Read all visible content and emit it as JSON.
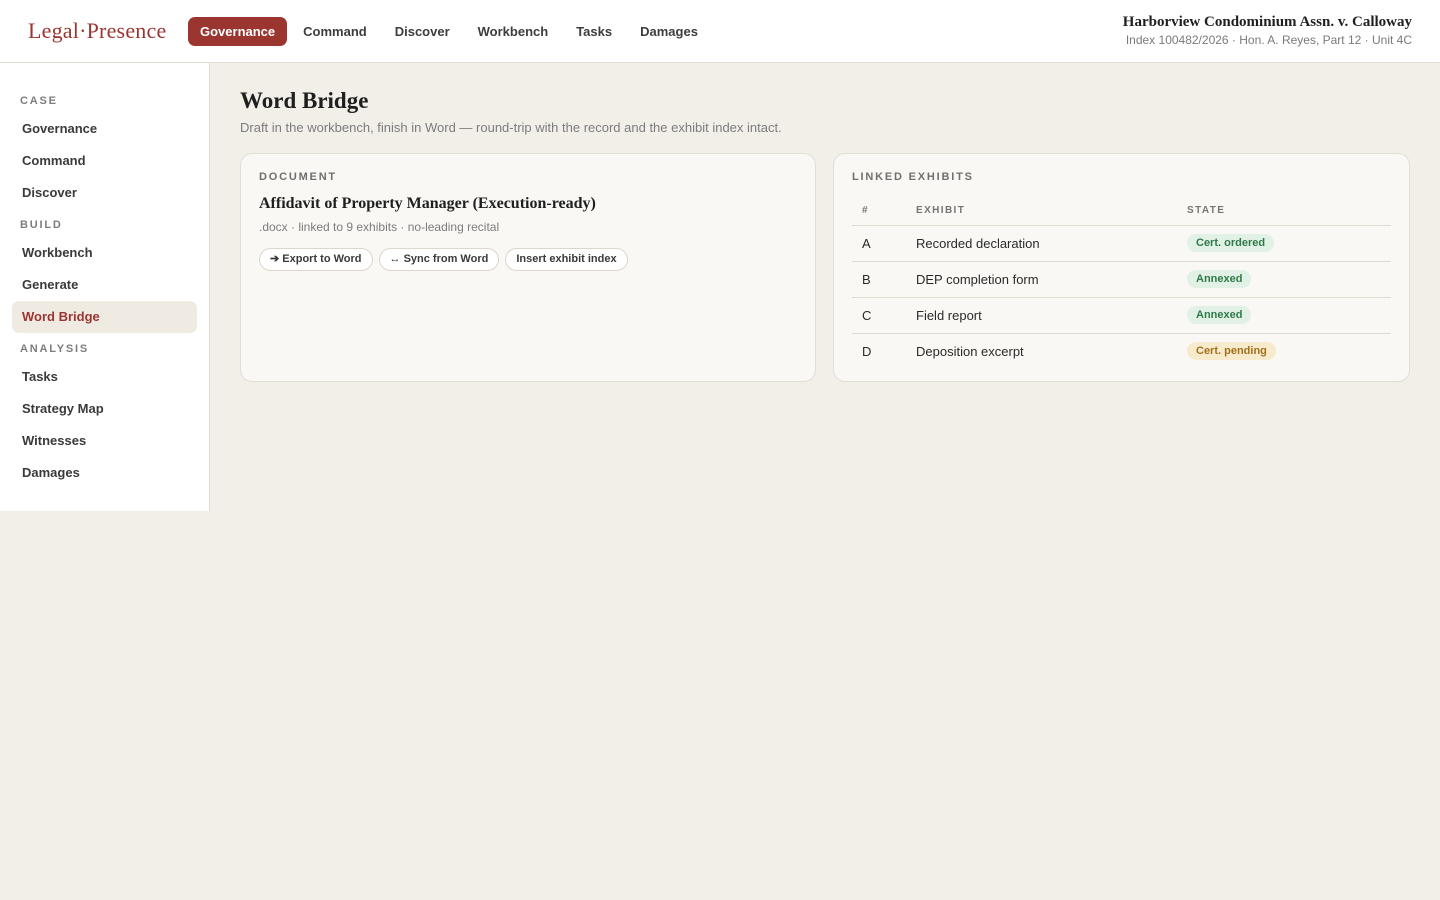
{
  "brand": {
    "left": "Legal",
    "dot": "·",
    "right": "Presence"
  },
  "topnav": {
    "items": [
      {
        "label": "Governance",
        "active": true
      },
      {
        "label": "Command",
        "active": false
      },
      {
        "label": "Discover",
        "active": false
      },
      {
        "label": "Workbench",
        "active": false
      },
      {
        "label": "Tasks",
        "active": false
      },
      {
        "label": "Damages",
        "active": false
      }
    ]
  },
  "case": {
    "title": "Harborview Condominium Assn. v. Calloway",
    "subtitle": "Index 100482/2026 · Hon. A. Reyes, Part 12 · Unit 4C"
  },
  "sidebar": {
    "groups": [
      {
        "heading": "CASE",
        "items": [
          {
            "label": "Governance",
            "active": false
          },
          {
            "label": "Command",
            "active": false
          },
          {
            "label": "Discover",
            "active": false
          }
        ]
      },
      {
        "heading": "BUILD",
        "items": [
          {
            "label": "Workbench",
            "active": false
          },
          {
            "label": "Generate",
            "active": false
          },
          {
            "label": "Word Bridge",
            "active": true
          }
        ]
      },
      {
        "heading": "ANALYSIS",
        "items": [
          {
            "label": "Tasks",
            "active": false
          },
          {
            "label": "Strategy Map",
            "active": false
          },
          {
            "label": "Witnesses",
            "active": false
          },
          {
            "label": "Damages",
            "active": false
          }
        ]
      }
    ]
  },
  "page": {
    "title": "Word Bridge",
    "subtitle": "Draft in the workbench, finish in Word — round-trip with the record and the exhibit index intact."
  },
  "document": {
    "label": "DOCUMENT",
    "title": "Affidavit of Property Manager (Execution-ready)",
    "meta": ".docx · linked to 9 exhibits · no-leading recital",
    "actions": [
      {
        "label": "➔ Export to Word",
        "icon": "arrow-right-icon"
      },
      {
        "label": "↔ Sync from Word",
        "icon": "sync-icon"
      },
      {
        "label": "Insert exhibit index",
        "icon": ""
      }
    ]
  },
  "exhibits": {
    "label": "LINKED EXHIBITS",
    "columns": [
      "#",
      "EXHIBIT",
      "STATE"
    ],
    "rows": [
      {
        "id": "A",
        "name": "Recorded declaration",
        "state": "Cert. ordered",
        "tone": "green"
      },
      {
        "id": "B",
        "name": "DEP completion form",
        "state": "Annexed",
        "tone": "green"
      },
      {
        "id": "C",
        "name": "Field report",
        "state": "Annexed",
        "tone": "green"
      },
      {
        "id": "D",
        "name": "Deposition excerpt",
        "state": "Cert. pending",
        "tone": "amber"
      }
    ]
  },
  "colors": {
    "accent": "#9a3530",
    "background": "#f2efe9",
    "badge_green_bg": "#e2f1e6",
    "badge_amber_bg": "#f8ebcd"
  }
}
